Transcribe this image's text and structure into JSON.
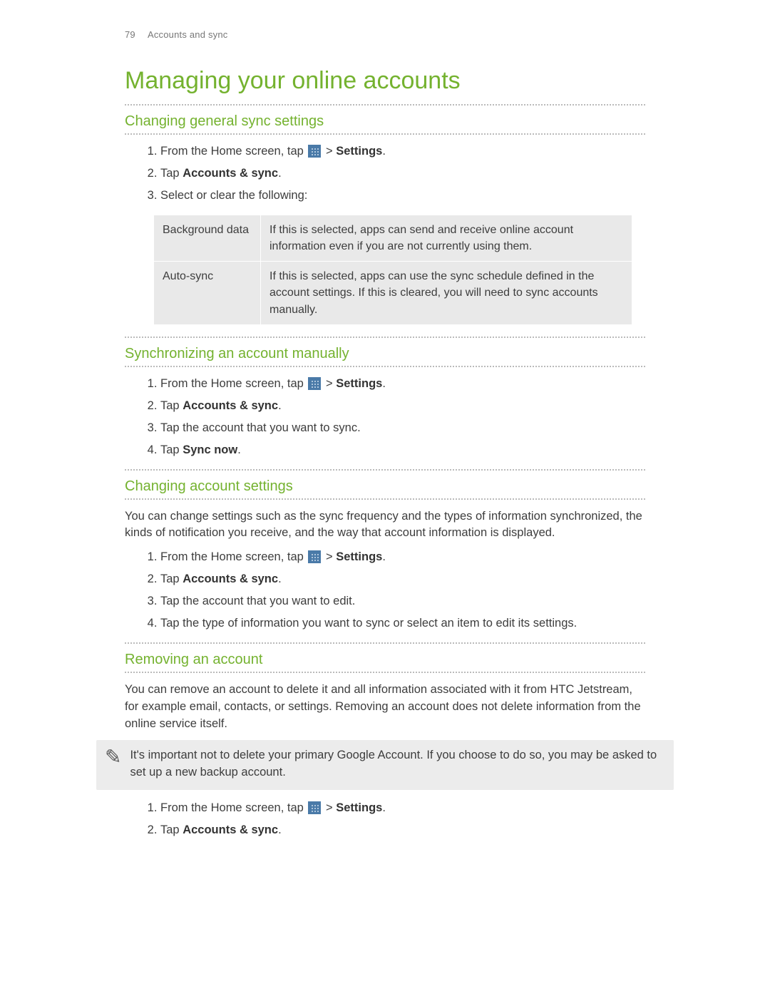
{
  "header": {
    "page_number": "79",
    "section": "Accounts and sync"
  },
  "title": "Managing your online accounts",
  "sections": {
    "s1": {
      "heading": "Changing general sync settings",
      "steps": {
        "a_pre": "From the Home screen, tap ",
        "a_post1": " > ",
        "a_bold": "Settings",
        "a_post2": ".",
        "b_pre": "Tap ",
        "b_bold": "Accounts & sync",
        "b_post": ".",
        "c": "Select or clear the following:"
      },
      "table": {
        "r1_label": "Background data",
        "r1_desc": "If this is selected, apps can send and receive online account information even if you are not currently using them.",
        "r2_label": "Auto-sync",
        "r2_desc": "If this is selected, apps can use the sync schedule defined in the account settings. If this is cleared, you will need to sync accounts manually."
      }
    },
    "s2": {
      "heading": "Synchronizing an account manually",
      "steps": {
        "a_pre": "From the Home screen, tap ",
        "a_post1": " > ",
        "a_bold": "Settings",
        "a_post2": ".",
        "b_pre": "Tap ",
        "b_bold": "Accounts & sync",
        "b_post": ".",
        "c": "Tap the account that you want to sync.",
        "d_pre": "Tap ",
        "d_bold": "Sync now",
        "d_post": "."
      }
    },
    "s3": {
      "heading": "Changing account settings",
      "intro": "You can change settings such as the sync frequency and the types of information synchronized, the kinds of notification you receive, and the way that account information is displayed.",
      "steps": {
        "a_pre": "From the Home screen, tap ",
        "a_post1": " > ",
        "a_bold": "Settings",
        "a_post2": ".",
        "b_pre": "Tap ",
        "b_bold": "Accounts & sync",
        "b_post": ".",
        "c": "Tap the account that you want to edit.",
        "d": "Tap the type of information you want to sync or select an item to edit its settings."
      }
    },
    "s4": {
      "heading": "Removing an account",
      "intro": "You can remove an account to delete it and all information associated with it from HTC Jetstream, for example email, contacts, or settings. Removing an account does not delete information from the online service itself.",
      "note": "It's important not to delete your primary Google Account. If you choose to do so, you may be asked to set up a new backup account.",
      "steps": {
        "a_pre": "From the Home screen, tap ",
        "a_post1": " > ",
        "a_bold": "Settings",
        "a_post2": ".",
        "b_pre": "Tap ",
        "b_bold": "Accounts & sync",
        "b_post": "."
      }
    }
  }
}
